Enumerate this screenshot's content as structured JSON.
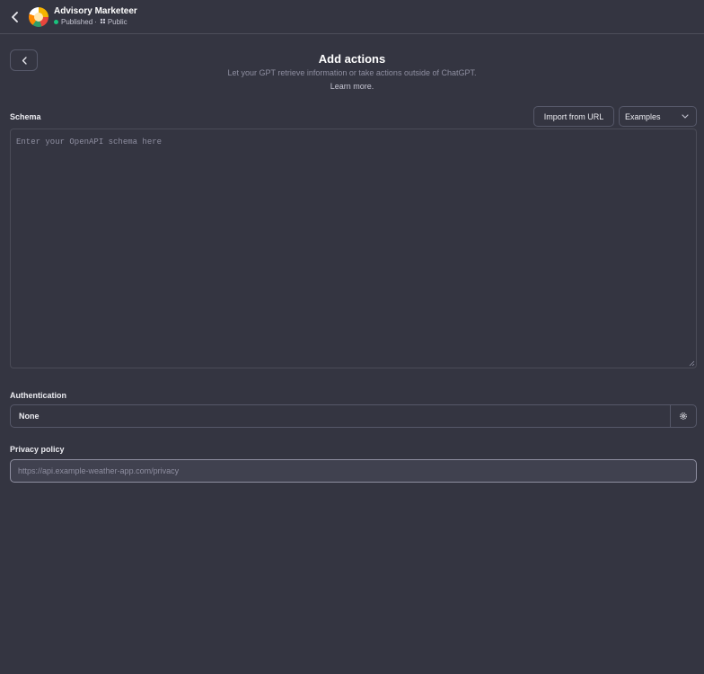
{
  "gpt": {
    "name": "Advisory Marketeer",
    "status": "Published",
    "separator": "·",
    "visibility": "Public"
  },
  "header": {
    "title": "Add actions",
    "subtitle": "Let your GPT retrieve information or take actions outside of ChatGPT.",
    "learn_more": "Learn more."
  },
  "schema": {
    "label": "Schema",
    "import_button": "Import from URL",
    "examples_button": "Examples",
    "placeholder": "Enter your OpenAPI schema here",
    "value": ""
  },
  "authentication": {
    "label": "Authentication",
    "value": "None"
  },
  "privacy": {
    "label": "Privacy policy",
    "placeholder": "https://api.example-weather-app.com/privacy",
    "value": ""
  },
  "colors": {
    "background": "#343541",
    "border": "#565869",
    "published_dot": "#19c37d"
  }
}
